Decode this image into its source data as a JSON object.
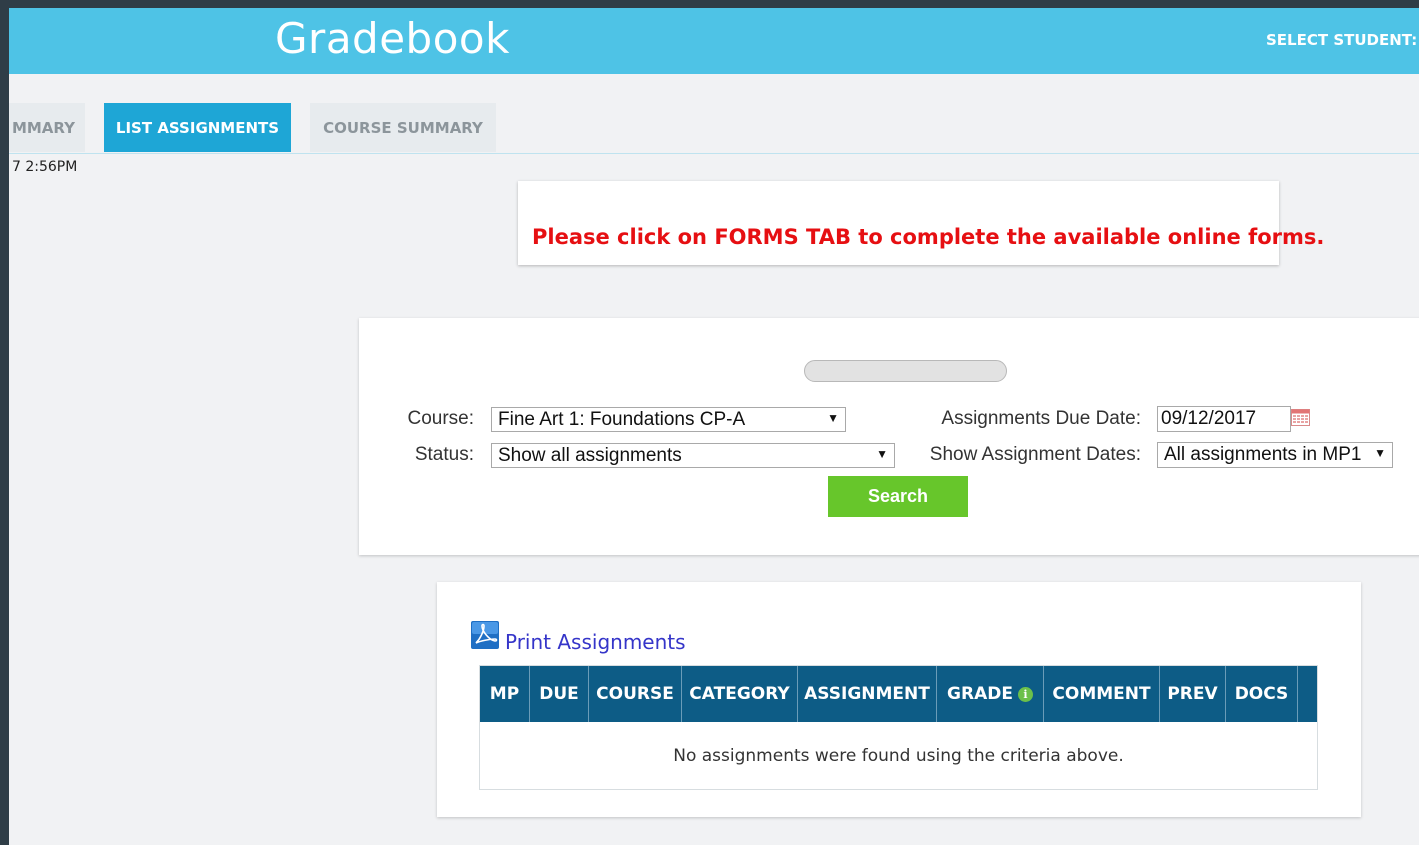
{
  "header": {
    "title": "Gradebook",
    "select_student_label": "SELECT STUDENT:"
  },
  "tabs": [
    {
      "label": "MMARY",
      "active": false
    },
    {
      "label": "LIST ASSIGNMENTS",
      "active": true
    },
    {
      "label": "COURSE SUMMARY",
      "active": false
    }
  ],
  "timestamp": "7 2:56PM",
  "notice": {
    "text": "Please click on FORMS TAB to complete the available online forms."
  },
  "filters": {
    "course_label": "Course:",
    "course_value": "Fine Art 1: Foundations CP-A",
    "status_label": "Status:",
    "status_value": "Show all assignments",
    "due_date_label": "Assignments Due Date:",
    "due_date_value": "09/12/2017",
    "show_dates_label": "Show Assignment Dates:",
    "show_dates_value": "All assignments in MP1",
    "search_label": "Search"
  },
  "results": {
    "print_label": "Print Assignments",
    "columns": [
      "MP",
      "DUE",
      "COURSE",
      "CATEGORY",
      "ASSIGNMENT",
      "GRADE",
      "COMMENT",
      "PREV",
      "DOCS"
    ],
    "empty_message": "No assignments were found using the criteria above."
  },
  "colors": {
    "header_bg": "#4ec3e6",
    "tab_active_bg": "#1ea6d6",
    "notice_text": "#e60f12",
    "search_button": "#67c62b",
    "table_header_bg": "#0d5c86"
  },
  "icons": {
    "calendar": "calendar-icon",
    "pdf": "pdf-icon",
    "grade_info": "info-icon"
  }
}
